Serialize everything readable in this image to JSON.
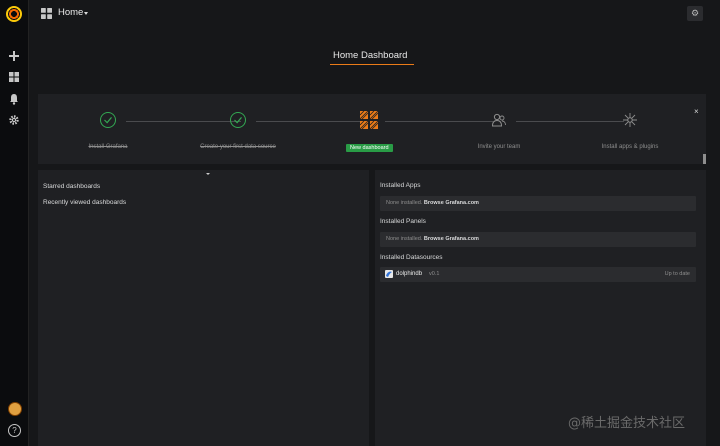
{
  "app": {
    "title": "Home"
  },
  "sidebar": {
    "items": [
      {
        "icon": "plus-icon"
      },
      {
        "icon": "dashboards-icon"
      },
      {
        "icon": "bell-icon"
      },
      {
        "icon": "gear-icon"
      }
    ],
    "help_glyph": "?"
  },
  "dashboard": {
    "title": "Home Dashboard"
  },
  "getting_started": {
    "close_glyph": "×",
    "steps": [
      {
        "label": "Install Grafana",
        "done": true
      },
      {
        "label": "Create your first data source",
        "done": true
      },
      {
        "label": "New dashboard",
        "active": true
      },
      {
        "label": "Invite your team",
        "done": false
      },
      {
        "label": "Install apps & plugins",
        "done": false
      }
    ]
  },
  "left": {
    "starred": "Starred dashboards",
    "recent": "Recently viewed dashboards"
  },
  "right": {
    "installed_apps": {
      "title": "Installed Apps",
      "none_label": "None installed.",
      "link": "Browse Grafana.com"
    },
    "installed_panels": {
      "title": "Installed Panels",
      "none_label": "None installed.",
      "link": "Browse Grafana.com"
    },
    "installed_datasources": {
      "title": "Installed Datasources",
      "items": [
        {
          "name": "dolphindb",
          "version": "v0.1",
          "status": "Up to date"
        }
      ]
    }
  },
  "watermark": "@稀土掘金技术社区"
}
